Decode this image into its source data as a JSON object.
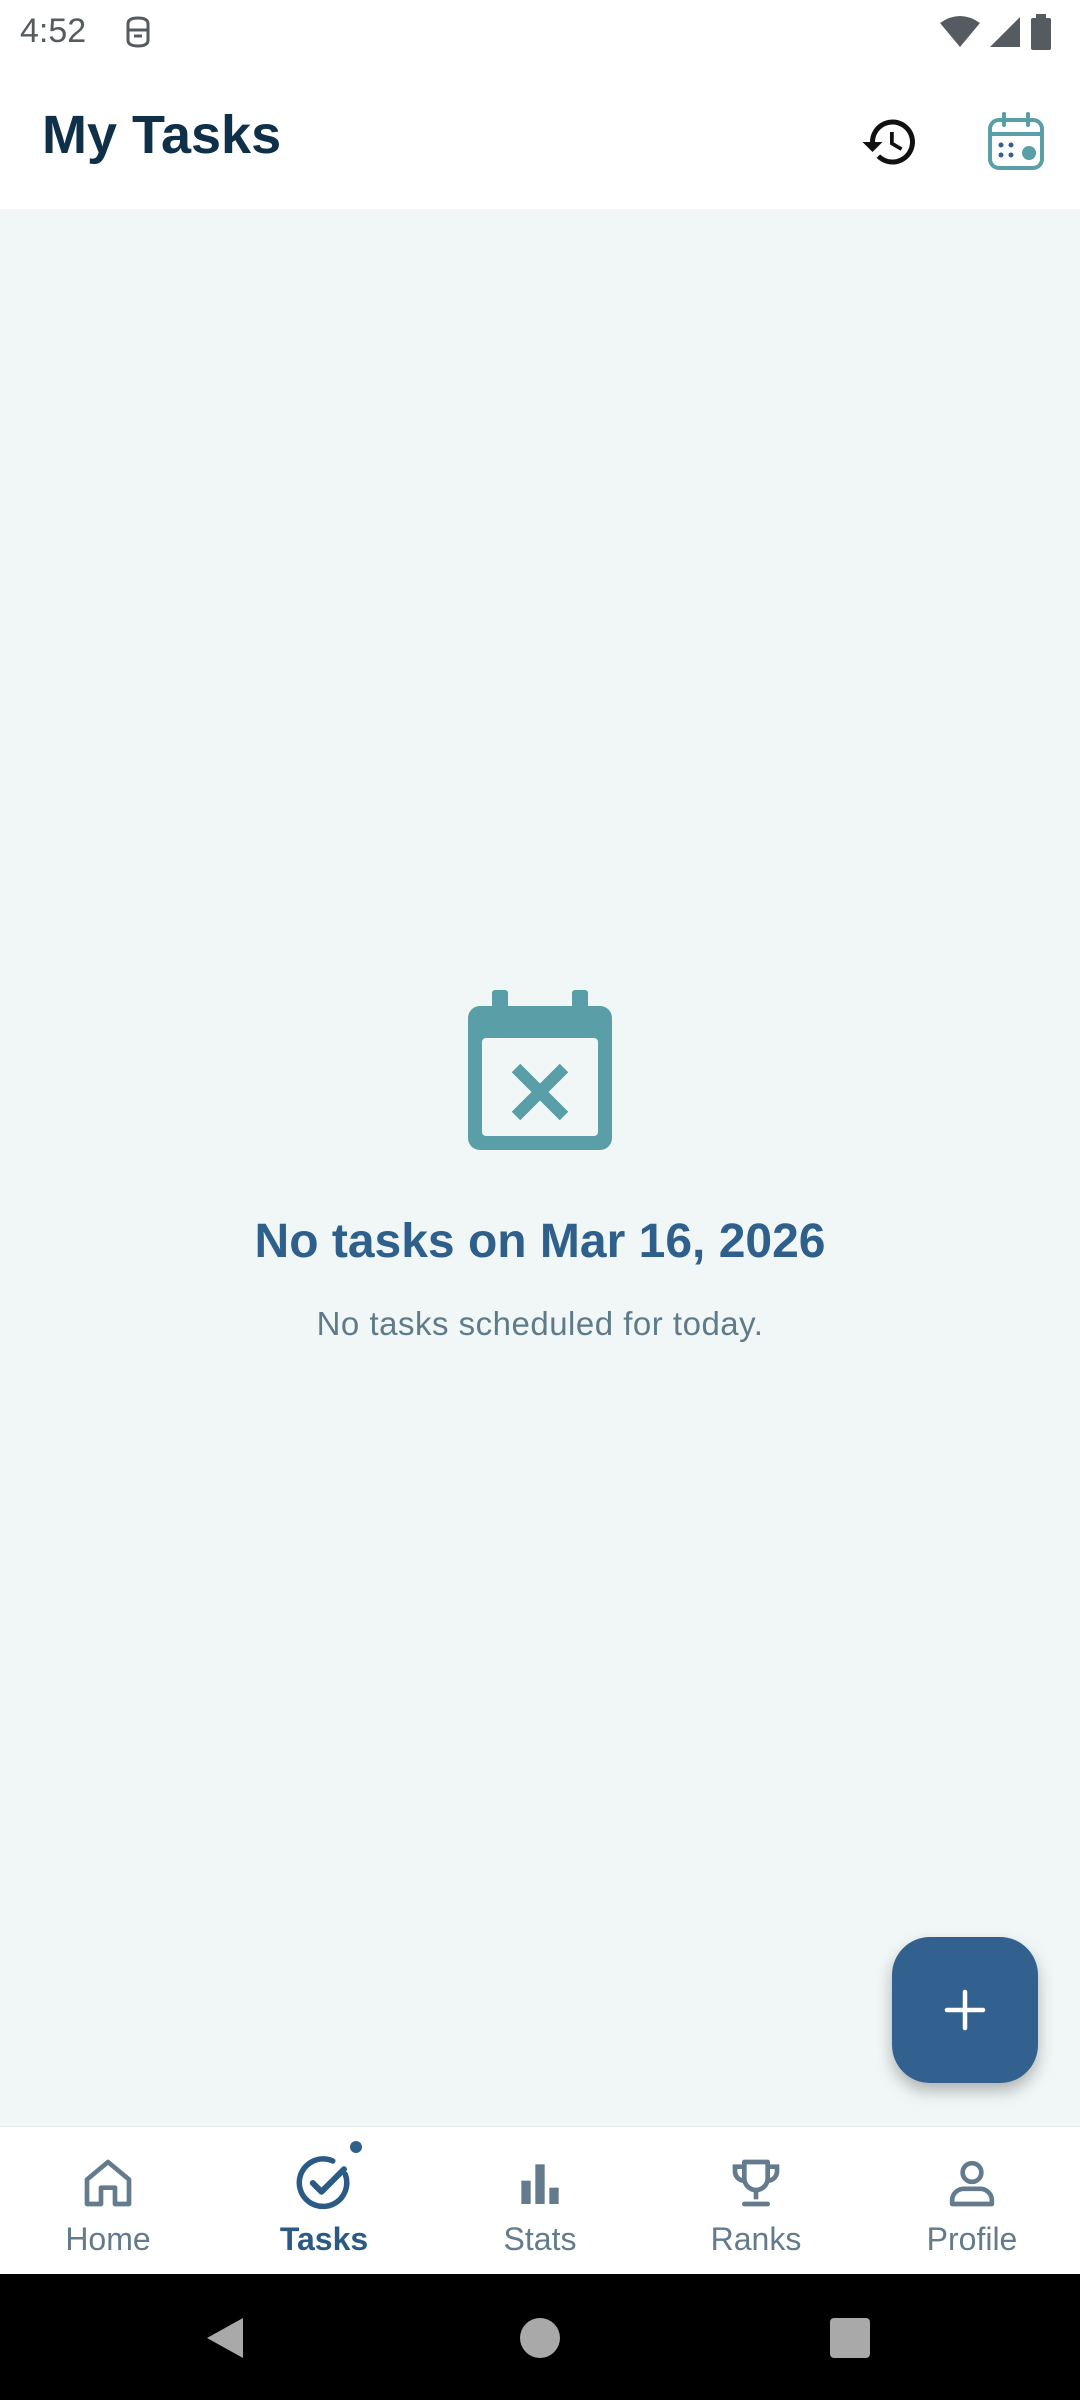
{
  "status_bar": {
    "time": "4:52",
    "icons": [
      "app-notification-icon",
      "wifi-icon",
      "signal-icon",
      "battery-icon"
    ]
  },
  "app_bar": {
    "title": "My Tasks",
    "actions": [
      "history-icon",
      "calendar-icon"
    ]
  },
  "empty_state": {
    "icon": "calendar-x-icon",
    "title": "No tasks on Mar 16, 2026",
    "subtitle": "No tasks scheduled for today."
  },
  "fab": {
    "icon": "plus-icon"
  },
  "bottom_nav": {
    "active": "Tasks",
    "items": [
      {
        "label": "Home",
        "icon": "home-icon"
      },
      {
        "label": "Tasks",
        "icon": "task-check-icon"
      },
      {
        "label": "Stats",
        "icon": "bar-chart-icon"
      },
      {
        "label": "Ranks",
        "icon": "trophy-icon"
      },
      {
        "label": "Profile",
        "icon": "person-icon"
      }
    ]
  },
  "colors": {
    "primary": "#33618f",
    "title_text": "#10304a",
    "background": "#f1f7f7",
    "empty_icon": "#5a9ea7"
  }
}
